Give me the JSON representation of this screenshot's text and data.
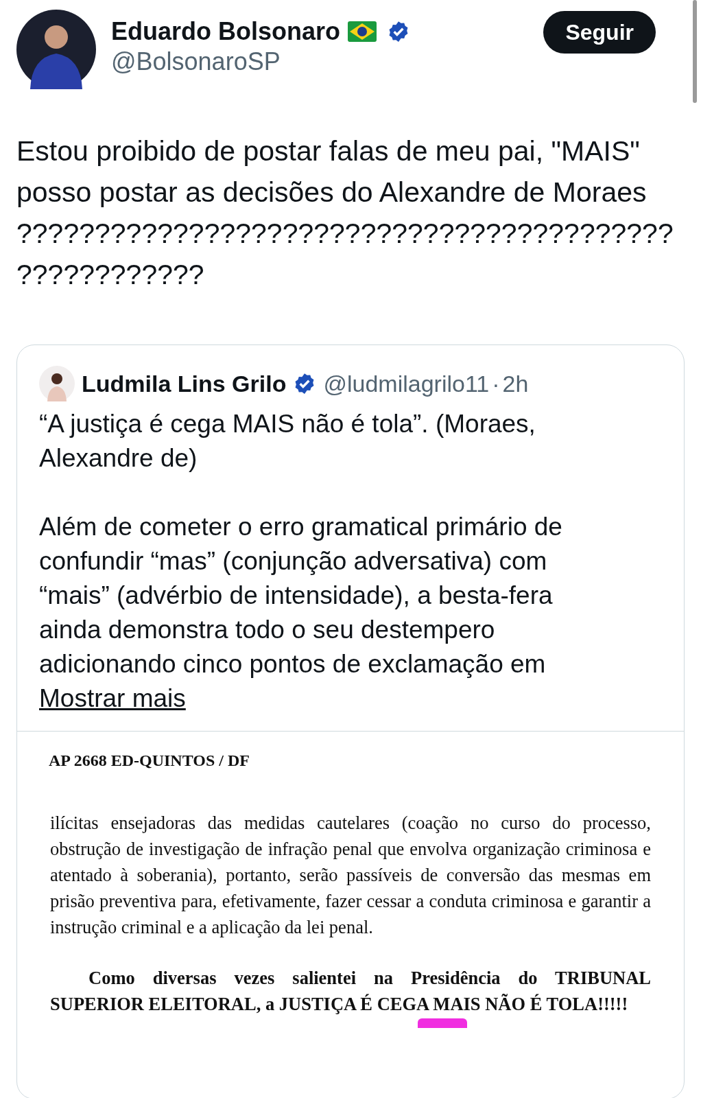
{
  "author": {
    "name": "Eduardo Bolsonaro",
    "handle": "@BolsonaroSP",
    "verified": true,
    "follow_button": "Seguir"
  },
  "text": "Estou proibido de postar falas de meu pai, \"MAIS\" posso postar as decisões do Alexandre de Moraes ??????????????????????????????????????????????????????",
  "quote": {
    "author": {
      "name": "Ludmila Lins Grilo",
      "verified": true,
      "handle": "@ludmilagrilo11",
      "separator": "·",
      "time": "2h"
    },
    "paragraphs": [
      "“A justiça é cega MAIS não é tola”. (Moraes, Alexandre de)",
      "Além de cometer o erro gramatical primário de confundir “mas” (conjunção adversativa) com “mais” (advérbio de intensidade), a besta-fera ainda demonstra todo o seu destempero adicionando cinco pontos de exclamação em"
    ],
    "more_link": "Mostrar mais",
    "document": {
      "header": "AP 2668 ED-QUINTOS / DF",
      "paragraphs": [
        {
          "kind": "plain",
          "text": "ilícitas ensejadoras das medidas cautelares (coação no curso do processo, obstrução de investigação de infração penal que envolva organização criminosa e atentado à soberania), portanto, serão passíveis de conversão das mesmas em prisão preventiva para, efetivamente, fazer cessar a conduta criminosa e garantir a instrução criminal e a aplicação da lei penal."
        },
        {
          "kind": "bold",
          "text": "Como diversas vezes salientei na Presidência do TRIBUNAL SUPERIOR ELEITORAL, a JUSTIÇA É CEGA MAIS NÃO É TOLA!!!!!"
        }
      ]
    }
  }
}
